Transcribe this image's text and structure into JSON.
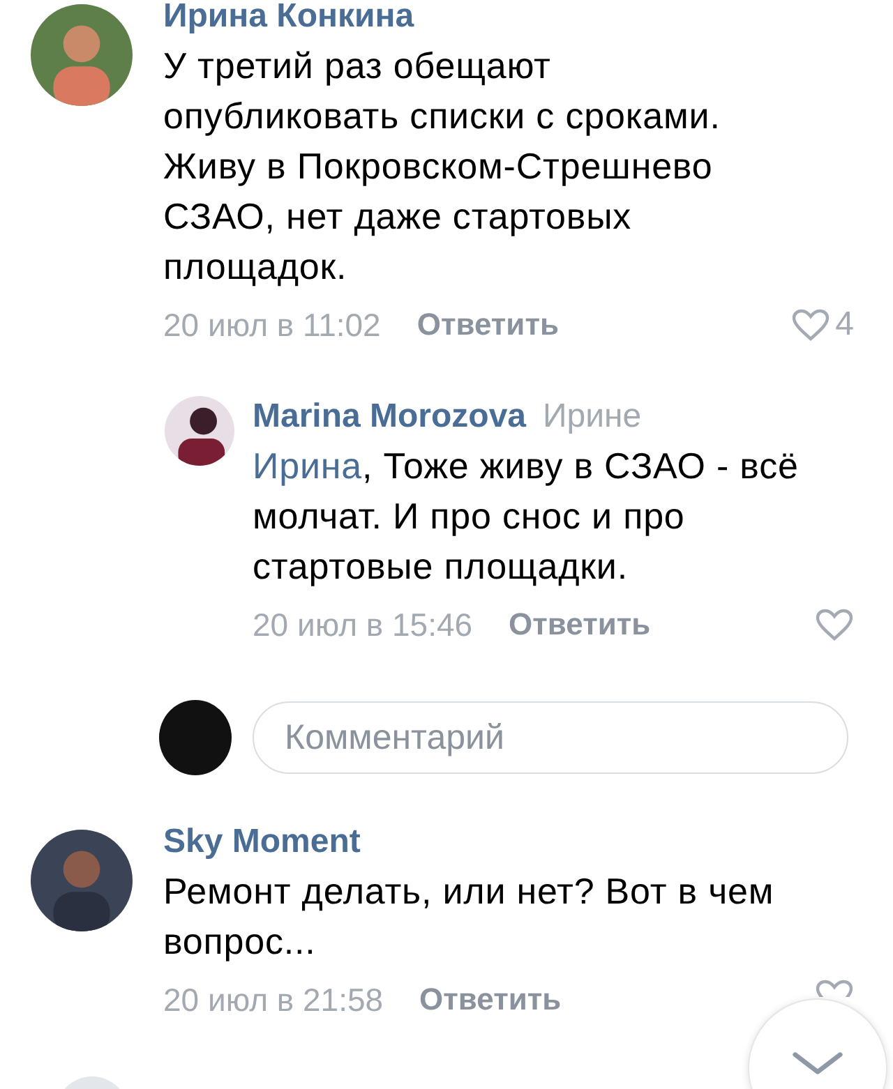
{
  "comments": [
    {
      "author": "Ирина Конкина",
      "text": "У третий раз обещают опубликовать списки с сроками. Живу в Покровском-Стрешнево СЗАО, нет даже стартовых площадок.",
      "date": "20 июл в 11:02",
      "reply_label": "Ответить",
      "likes": "4",
      "replies": [
        {
          "author": "Marina Morozova",
          "reply_to": "Ирине",
          "mention": "Ирина",
          "text": ", Тоже живу в СЗАО - всё молчат. И про снос и про стартовые площадки.",
          "date": "20 июл в 15:46",
          "reply_label": "Ответить"
        }
      ],
      "comment_field": {
        "placeholder": "Комментарий"
      }
    },
    {
      "author": "Sky Moment",
      "text": "Ремонт делать, или нет? Вот в чем вопрос...",
      "date": "20 июл в 21:58",
      "reply_label": "Ответить"
    }
  ]
}
